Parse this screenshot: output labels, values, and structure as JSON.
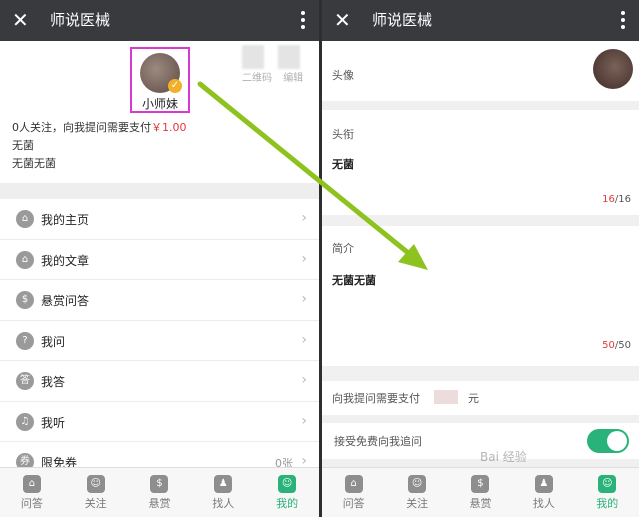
{
  "left": {
    "titlebar": {
      "close": "✕",
      "title": "师说医械"
    },
    "profile": {
      "username": "小师妹",
      "badge": "✓",
      "links": [
        "二维码",
        "编辑"
      ],
      "follow_prefix": "0人关注，向我提问需要支付",
      "price": "￥1.00",
      "line2": "无菌",
      "line3": "无菌无菌"
    },
    "menu": [
      {
        "icon": "home-icon",
        "glyph": "⌂",
        "label": "我的主页",
        "extra": ""
      },
      {
        "icon": "article-icon",
        "glyph": "⌂",
        "label": "我的文章",
        "extra": ""
      },
      {
        "icon": "reward-icon",
        "glyph": "$",
        "label": "悬赏问答",
        "extra": ""
      },
      {
        "icon": "question-icon",
        "glyph": "?",
        "label": "我问",
        "extra": ""
      },
      {
        "icon": "answer-icon",
        "glyph": "答",
        "label": "我答",
        "extra": ""
      },
      {
        "icon": "headphones-icon",
        "glyph": "♫",
        "label": "我听",
        "extra": ""
      },
      {
        "icon": "coupon-icon",
        "glyph": "券",
        "label": "限免券",
        "extra": "0张"
      }
    ]
  },
  "right": {
    "titlebar": {
      "close": "✕",
      "title": "师说医械"
    },
    "avatar_label": "头像",
    "title_label": "头衔",
    "title_value": "无菌",
    "title_count_cur": "16",
    "title_count_max": "/16",
    "intro_label": "简介",
    "intro_value": "无菌无菌",
    "intro_count_cur": "50",
    "intro_count_max": "/50",
    "pay_label": "向我提问需要支付",
    "pay_unit": "元",
    "follow_label": "接受免费向我追问",
    "follow_enabled": true
  },
  "tabs": [
    {
      "label": "问答",
      "icon": "qa-icon",
      "glyph": "⌂"
    },
    {
      "label": "关注",
      "icon": "follow-icon",
      "glyph": "☺"
    },
    {
      "label": "悬赏",
      "icon": "reward-tab-icon",
      "glyph": "$"
    },
    {
      "label": "找人",
      "icon": "find-people-icon",
      "glyph": "♟"
    },
    {
      "label": "我的",
      "icon": "me-icon",
      "glyph": "☺",
      "active": true
    }
  ],
  "colors": {
    "titlebar": "#393a3e",
    "accent": "#29b27a",
    "price": "#e0383e",
    "highlight": "#d63ad3",
    "arrow": "#8dc21f"
  },
  "watermark": "Bai 经验"
}
